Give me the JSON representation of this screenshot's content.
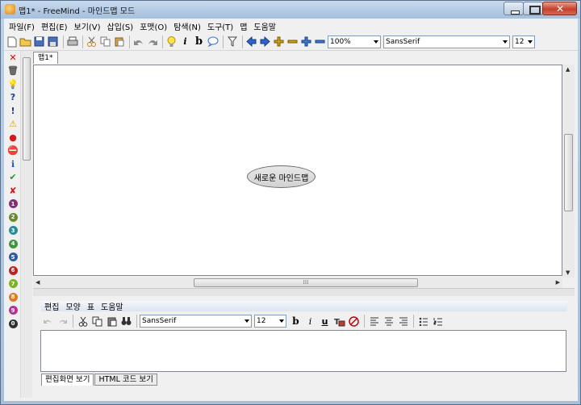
{
  "window": {
    "title": "맵1* - FreeMind - 마인드맵 모드",
    "close_label": "✕"
  },
  "menu": [
    "파일(F)",
    "편집(E)",
    "보기(V)",
    "삽입(S)",
    "포맷(O)",
    "탐색(N)",
    "도구(T)",
    "맵",
    "도움말"
  ],
  "toolbar": {
    "zoom_value": "100%",
    "font_family": "SansSerif",
    "font_size": "12",
    "italic_label": "i",
    "bold_label": "b"
  },
  "iconbar": {
    "icons": [
      {
        "name": "remove-last-icon-icon",
        "glyph": "✕",
        "color": "#cc0000"
      },
      {
        "name": "remove-all-icons-icon",
        "glyph": "🗑",
        "color": "#555555"
      },
      {
        "name": "idea-bulb-icon",
        "glyph": "💡",
        "color": "#e8c000"
      },
      {
        "name": "question-icon",
        "glyph": "?",
        "color": "#1a3c8c"
      },
      {
        "name": "exclamation-icon",
        "glyph": "!",
        "color": "#1a3c8c"
      },
      {
        "name": "warning-icon",
        "glyph": "⚠",
        "color": "#d9a400"
      },
      {
        "name": "stop-icon",
        "glyph": "●",
        "color": "#d11a1a"
      },
      {
        "name": "no-entry-icon",
        "glyph": "⛔",
        "color": "#d11a1a"
      },
      {
        "name": "info-icon",
        "glyph": "ℹ",
        "color": "#1f4fbf"
      },
      {
        "name": "checkmark-icon",
        "glyph": "✔",
        "color": "#1f9a2a"
      },
      {
        "name": "cross-icon",
        "glyph": "✘",
        "color": "#d11a1a"
      }
    ],
    "numbers": [
      {
        "label": "1",
        "color": "#8a2a7a"
      },
      {
        "label": "2",
        "color": "#6b8a2a"
      },
      {
        "label": "3",
        "color": "#2a8a9a"
      },
      {
        "label": "4",
        "color": "#3a9a3a"
      },
      {
        "label": "5",
        "color": "#2a5ab0"
      },
      {
        "label": "6",
        "color": "#c02020"
      },
      {
        "label": "7",
        "color": "#7ab02a"
      },
      {
        "label": "8",
        "color": "#e07a20"
      },
      {
        "label": "9",
        "color": "#c02aa0"
      },
      {
        "label": "0",
        "color": "#303030"
      }
    ]
  },
  "map": {
    "tab_label": "맵1*",
    "root_node": "새로운 마인드맵"
  },
  "notes": {
    "menu": [
      "편집",
      "모양",
      "표",
      "도움말"
    ],
    "font_family": "SansSerif",
    "font_size": "12",
    "bold_label": "b",
    "italic_label": "i",
    "underline_label": "u",
    "tabs": [
      "편집화면 보기",
      "HTML 코드 보기"
    ]
  }
}
